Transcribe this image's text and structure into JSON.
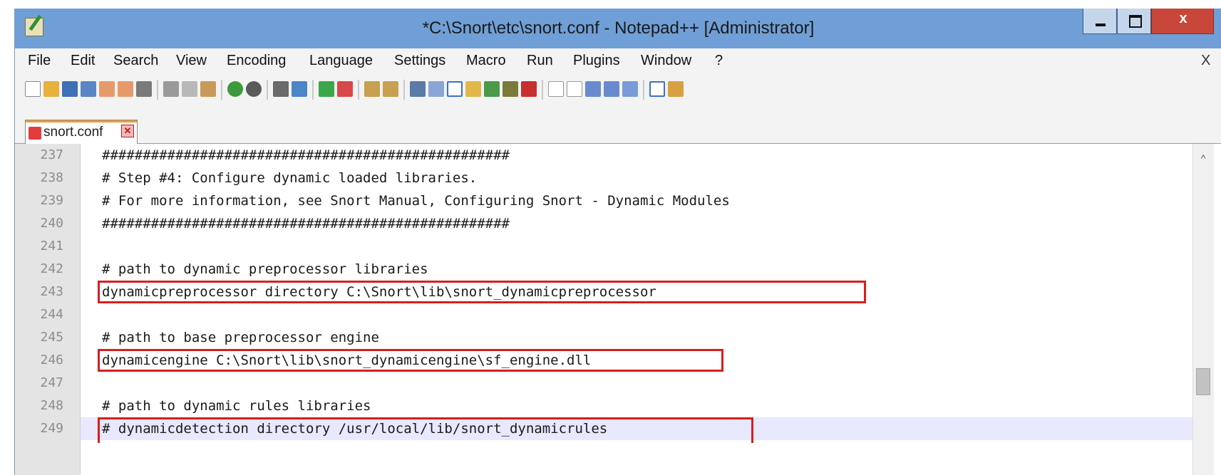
{
  "window": {
    "title": "*C:\\Snort\\etc\\snort.conf - Notepad++ [Administrator]",
    "close_glyph": "x"
  },
  "menu": {
    "items": [
      "File",
      "Edit",
      "Search",
      "View",
      "Encoding",
      "Language",
      "Settings",
      "Macro",
      "Run",
      "Plugins",
      "Window",
      "?"
    ],
    "close_glyph": "X"
  },
  "toolbar": {
    "icons": [
      "new-file-icon",
      "open-file-icon",
      "save-icon",
      "save-all-icon",
      "close-icon",
      "close-all-icon",
      "print-icon",
      "cut-icon",
      "copy-icon",
      "paste-icon",
      "undo-icon",
      "redo-icon",
      "find-icon",
      "replace-icon",
      "zoom-in-icon",
      "zoom-out-icon",
      "sync-vertical-icon",
      "sync-horizontal-icon",
      "word-wrap-icon",
      "show-all-chars-icon",
      "indent-guide-icon",
      "doc-map-icon",
      "function-list-icon",
      "folder-workspace-icon",
      "record-macro-icon",
      "stop-record-icon",
      "play-macro-icon",
      "run-macro-multiple-icon",
      "save-macro-icon",
      "spell-check-icon",
      "spell-options-icon"
    ]
  },
  "tab": {
    "label": "snort.conf",
    "close_glyph": "✕"
  },
  "editor": {
    "lines": [
      {
        "num": "237",
        "text": "##################################################"
      },
      {
        "num": "238",
        "text": "# Step #4: Configure dynamic loaded libraries."
      },
      {
        "num": "239",
        "text": "# For more information, see Snort Manual, Configuring Snort - Dynamic Modules"
      },
      {
        "num": "240",
        "text": "##################################################"
      },
      {
        "num": "241",
        "text": ""
      },
      {
        "num": "242",
        "text": "# path to dynamic preprocessor libraries"
      },
      {
        "num": "243",
        "text": "dynamicpreprocessor directory C:\\Snort\\lib\\snort_dynamicpreprocessor"
      },
      {
        "num": "244",
        "text": ""
      },
      {
        "num": "245",
        "text": "# path to base preprocessor engine"
      },
      {
        "num": "246",
        "text": "dynamicengine C:\\Snort\\lib\\snort_dynamicengine\\sf_engine.dll"
      },
      {
        "num": "247",
        "text": ""
      },
      {
        "num": "248",
        "text": "# path to dynamic rules libraries"
      },
      {
        "num": "249",
        "text": "# dynamicdetection directory /usr/local/lib/snort_dynamicrules"
      }
    ],
    "highlighted_lines": [
      "243",
      "246",
      "249"
    ],
    "current_line": "249",
    "highlight_color": "#d81e1e"
  },
  "scrollbar": {
    "up_glyph": "^"
  }
}
